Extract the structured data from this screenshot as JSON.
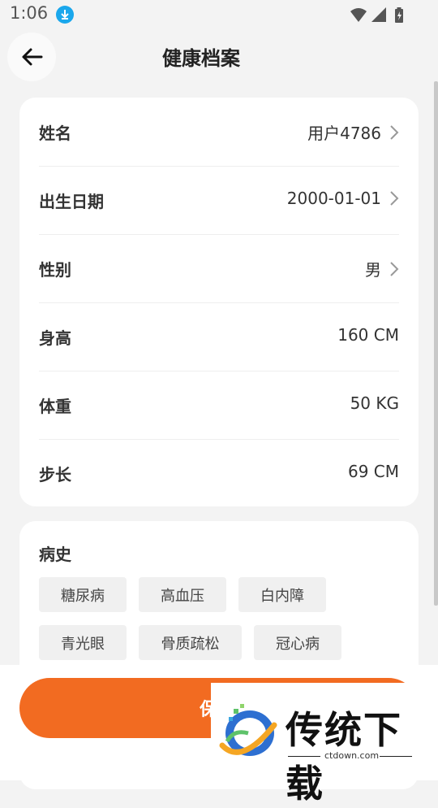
{
  "status_bar": {
    "time": "1:06"
  },
  "header": {
    "title": "健康档案"
  },
  "profile": {
    "rows": [
      {
        "label": "姓名",
        "value": "用户4786",
        "chevron": true
      },
      {
        "label": "出生日期",
        "value": "2000-01-01",
        "chevron": true
      },
      {
        "label": "性别",
        "value": "男",
        "chevron": true
      },
      {
        "label": "身高",
        "value": "160 CM",
        "chevron": false
      },
      {
        "label": "体重",
        "value": "50 KG",
        "chevron": false
      },
      {
        "label": "步长",
        "value": "69 CM",
        "chevron": false
      }
    ]
  },
  "history": {
    "title": "病史",
    "tags": [
      "糖尿病",
      "高血压",
      "白内障",
      "青光眼",
      "骨质疏松",
      "冠心病"
    ]
  },
  "footer": {
    "save_label": "保"
  },
  "watermark": {
    "brand": "传统下载",
    "url": "ctdown.com"
  },
  "colors": {
    "accent": "#f26b21",
    "download_badge": "#1aa7ec",
    "background": "#f3f3f3"
  }
}
